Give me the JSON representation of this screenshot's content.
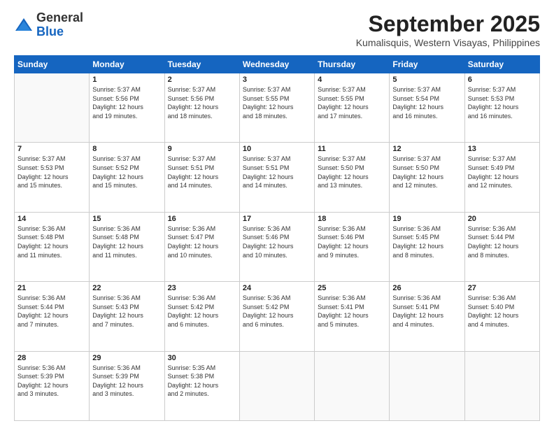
{
  "header": {
    "logo": {
      "line1": "General",
      "line2": "Blue"
    },
    "title": "September 2025",
    "location": "Kumalisquis, Western Visayas, Philippines"
  },
  "weekdays": [
    "Sunday",
    "Monday",
    "Tuesday",
    "Wednesday",
    "Thursday",
    "Friday",
    "Saturday"
  ],
  "weeks": [
    [
      {
        "day": "",
        "info": ""
      },
      {
        "day": "1",
        "info": "Sunrise: 5:37 AM\nSunset: 5:56 PM\nDaylight: 12 hours\nand 19 minutes."
      },
      {
        "day": "2",
        "info": "Sunrise: 5:37 AM\nSunset: 5:56 PM\nDaylight: 12 hours\nand 18 minutes."
      },
      {
        "day": "3",
        "info": "Sunrise: 5:37 AM\nSunset: 5:55 PM\nDaylight: 12 hours\nand 18 minutes."
      },
      {
        "day": "4",
        "info": "Sunrise: 5:37 AM\nSunset: 5:55 PM\nDaylight: 12 hours\nand 17 minutes."
      },
      {
        "day": "5",
        "info": "Sunrise: 5:37 AM\nSunset: 5:54 PM\nDaylight: 12 hours\nand 16 minutes."
      },
      {
        "day": "6",
        "info": "Sunrise: 5:37 AM\nSunset: 5:53 PM\nDaylight: 12 hours\nand 16 minutes."
      }
    ],
    [
      {
        "day": "7",
        "info": "Sunrise: 5:37 AM\nSunset: 5:53 PM\nDaylight: 12 hours\nand 15 minutes."
      },
      {
        "day": "8",
        "info": "Sunrise: 5:37 AM\nSunset: 5:52 PM\nDaylight: 12 hours\nand 15 minutes."
      },
      {
        "day": "9",
        "info": "Sunrise: 5:37 AM\nSunset: 5:51 PM\nDaylight: 12 hours\nand 14 minutes."
      },
      {
        "day": "10",
        "info": "Sunrise: 5:37 AM\nSunset: 5:51 PM\nDaylight: 12 hours\nand 14 minutes."
      },
      {
        "day": "11",
        "info": "Sunrise: 5:37 AM\nSunset: 5:50 PM\nDaylight: 12 hours\nand 13 minutes."
      },
      {
        "day": "12",
        "info": "Sunrise: 5:37 AM\nSunset: 5:50 PM\nDaylight: 12 hours\nand 12 minutes."
      },
      {
        "day": "13",
        "info": "Sunrise: 5:37 AM\nSunset: 5:49 PM\nDaylight: 12 hours\nand 12 minutes."
      }
    ],
    [
      {
        "day": "14",
        "info": "Sunrise: 5:36 AM\nSunset: 5:48 PM\nDaylight: 12 hours\nand 11 minutes."
      },
      {
        "day": "15",
        "info": "Sunrise: 5:36 AM\nSunset: 5:48 PM\nDaylight: 12 hours\nand 11 minutes."
      },
      {
        "day": "16",
        "info": "Sunrise: 5:36 AM\nSunset: 5:47 PM\nDaylight: 12 hours\nand 10 minutes."
      },
      {
        "day": "17",
        "info": "Sunrise: 5:36 AM\nSunset: 5:46 PM\nDaylight: 12 hours\nand 10 minutes."
      },
      {
        "day": "18",
        "info": "Sunrise: 5:36 AM\nSunset: 5:46 PM\nDaylight: 12 hours\nand 9 minutes."
      },
      {
        "day": "19",
        "info": "Sunrise: 5:36 AM\nSunset: 5:45 PM\nDaylight: 12 hours\nand 8 minutes."
      },
      {
        "day": "20",
        "info": "Sunrise: 5:36 AM\nSunset: 5:44 PM\nDaylight: 12 hours\nand 8 minutes."
      }
    ],
    [
      {
        "day": "21",
        "info": "Sunrise: 5:36 AM\nSunset: 5:44 PM\nDaylight: 12 hours\nand 7 minutes."
      },
      {
        "day": "22",
        "info": "Sunrise: 5:36 AM\nSunset: 5:43 PM\nDaylight: 12 hours\nand 7 minutes."
      },
      {
        "day": "23",
        "info": "Sunrise: 5:36 AM\nSunset: 5:42 PM\nDaylight: 12 hours\nand 6 minutes."
      },
      {
        "day": "24",
        "info": "Sunrise: 5:36 AM\nSunset: 5:42 PM\nDaylight: 12 hours\nand 6 minutes."
      },
      {
        "day": "25",
        "info": "Sunrise: 5:36 AM\nSunset: 5:41 PM\nDaylight: 12 hours\nand 5 minutes."
      },
      {
        "day": "26",
        "info": "Sunrise: 5:36 AM\nSunset: 5:41 PM\nDaylight: 12 hours\nand 4 minutes."
      },
      {
        "day": "27",
        "info": "Sunrise: 5:36 AM\nSunset: 5:40 PM\nDaylight: 12 hours\nand 4 minutes."
      }
    ],
    [
      {
        "day": "28",
        "info": "Sunrise: 5:36 AM\nSunset: 5:39 PM\nDaylight: 12 hours\nand 3 minutes."
      },
      {
        "day": "29",
        "info": "Sunrise: 5:36 AM\nSunset: 5:39 PM\nDaylight: 12 hours\nand 3 minutes."
      },
      {
        "day": "30",
        "info": "Sunrise: 5:35 AM\nSunset: 5:38 PM\nDaylight: 12 hours\nand 2 minutes."
      },
      {
        "day": "",
        "info": ""
      },
      {
        "day": "",
        "info": ""
      },
      {
        "day": "",
        "info": ""
      },
      {
        "day": "",
        "info": ""
      }
    ]
  ]
}
